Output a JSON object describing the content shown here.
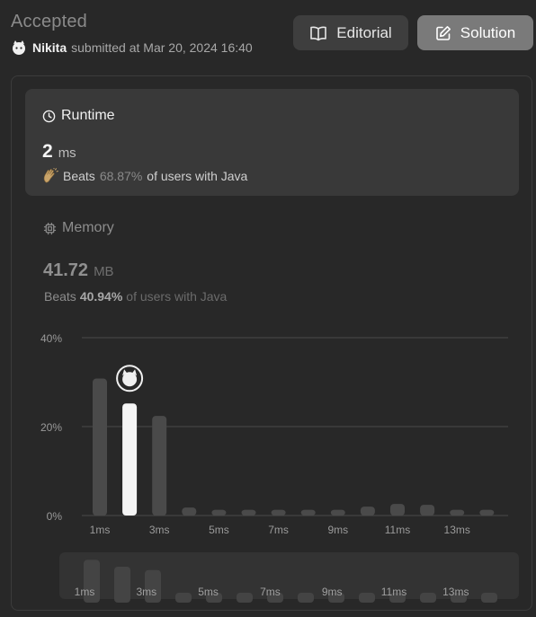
{
  "header": {
    "status": "Accepted",
    "user": "Nikita",
    "submitted_text": "submitted at Mar 20, 2024 16:40",
    "editorial_label": "Editorial",
    "solution_label": "Solution"
  },
  "runtime": {
    "title": "Runtime",
    "value": "2",
    "unit": "ms",
    "beats_label": "Beats",
    "beats_pct": "68.87%",
    "beats_suffix": "of users with Java"
  },
  "memory": {
    "title": "Memory",
    "value": "41.72",
    "unit": "MB",
    "beats_label": "Beats",
    "beats_pct": "40.94%",
    "beats_suffix": "of users with Java"
  },
  "colors": {
    "bar": "#4a4a4a",
    "highlight": "#f5f5f5",
    "grid": "#4a4a4a",
    "tick": "#9a9a9a"
  },
  "chart_data": {
    "type": "bar",
    "categories": [
      "1ms",
      "2ms",
      "3ms",
      "4ms",
      "5ms",
      "6ms",
      "7ms",
      "8ms",
      "9ms",
      "10ms",
      "11ms",
      "12ms",
      "13ms",
      "14ms"
    ],
    "values": [
      30.8,
      25.2,
      22.4,
      1.8,
      1.3,
      1.3,
      1.3,
      1.3,
      1.3,
      2.0,
      2.6,
      2.4,
      1.3,
      1.3
    ],
    "highlight_index": 1,
    "y_ticks": [
      "0%",
      "20%",
      "40%"
    ],
    "x_tick_labels": [
      "1ms",
      "3ms",
      "5ms",
      "7ms",
      "9ms",
      "11ms",
      "13ms"
    ],
    "x_tick_indices": [
      0,
      2,
      4,
      6,
      8,
      10,
      12
    ],
    "ylim": [
      0,
      40
    ],
    "grid": true
  }
}
